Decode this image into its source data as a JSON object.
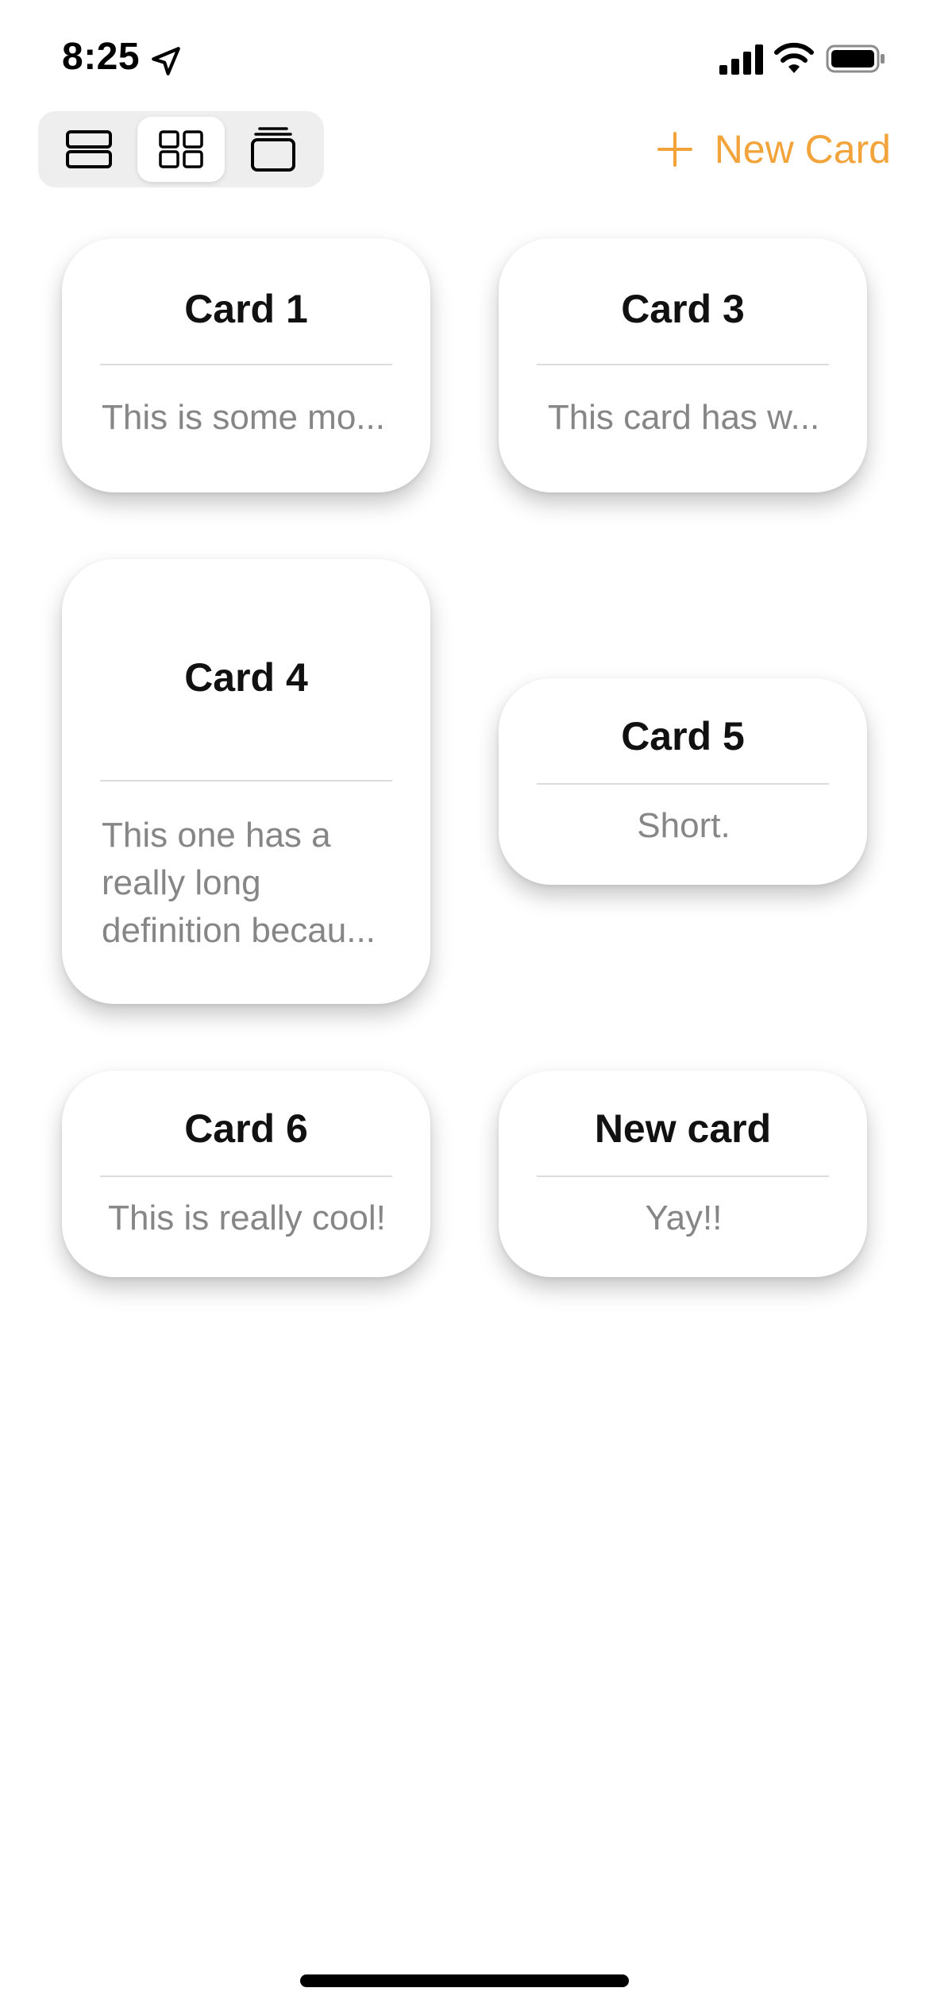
{
  "status_bar": {
    "time": "8:25",
    "icons": [
      "location-arrow-icon",
      "cellular-signal-icon",
      "wifi-icon",
      "battery-icon"
    ]
  },
  "toolbar": {
    "view_modes": [
      {
        "name": "list-layout-icon",
        "selected": false
      },
      {
        "name": "grid-layout-icon",
        "selected": true
      },
      {
        "name": "stack-layout-icon",
        "selected": false
      }
    ],
    "new_card_label": "New Card"
  },
  "colors": {
    "accent": "#f2a33a",
    "card_background": "#ffffff",
    "body_text": "#868686",
    "segment_background": "#eeeeef"
  },
  "cards": [
    {
      "title": "Card 1",
      "body": "This is some mo..."
    },
    {
      "title": "Card 3",
      "body": "This card has w..."
    },
    {
      "title": "Card 4",
      "body": "This one has a really long definition becau..."
    },
    {
      "title": "Card 5",
      "body": "Short."
    },
    {
      "title": "Card 6",
      "body": "This is really cool!"
    },
    {
      "title": "New card",
      "body": "Yay!!"
    }
  ]
}
